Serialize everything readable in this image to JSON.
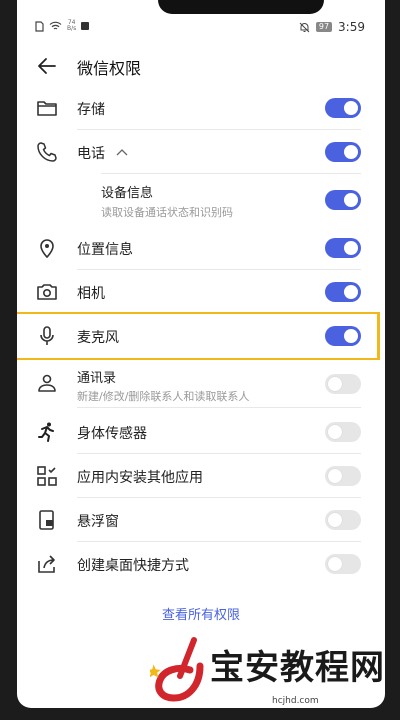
{
  "status_bar": {
    "speed_value": "74",
    "speed_unit": "B/s",
    "battery": "97",
    "time": "3:59"
  },
  "header": {
    "title": "微信权限"
  },
  "permissions": [
    {
      "label": "存储",
      "icon": "folder-icon",
      "enabled": true
    },
    {
      "label": "电话",
      "icon": "phone-icon",
      "enabled": true
    },
    {
      "label": "设备信息",
      "subtitle": "读取设备通话状态和识别码",
      "enabled": true
    },
    {
      "label": "位置信息",
      "icon": "location-icon",
      "enabled": true
    },
    {
      "label": "相机",
      "icon": "camera-icon",
      "enabled": true
    },
    {
      "label": "麦克风",
      "icon": "microphone-icon",
      "enabled": true
    },
    {
      "label": "通讯录",
      "subtitle": "新建/修改/删除联系人和读取联系人",
      "icon": "contacts-icon",
      "enabled": false
    },
    {
      "label": "身体传感器",
      "icon": "running-icon",
      "enabled": false
    },
    {
      "label": "应用内安装其他应用",
      "icon": "apps-icon",
      "enabled": false
    },
    {
      "label": "悬浮窗",
      "icon": "floating-window-icon",
      "enabled": false
    },
    {
      "label": "创建桌面快捷方式",
      "icon": "shortcut-icon",
      "enabled": false
    }
  ],
  "view_all": "查看所有权限",
  "watermark": {
    "title": "宝安教程网",
    "url": "hcjhd.com"
  },
  "colors": {
    "accent": "#4a62e0",
    "highlight": "#f2b81b",
    "toggle_off": "#e6e6e6"
  }
}
